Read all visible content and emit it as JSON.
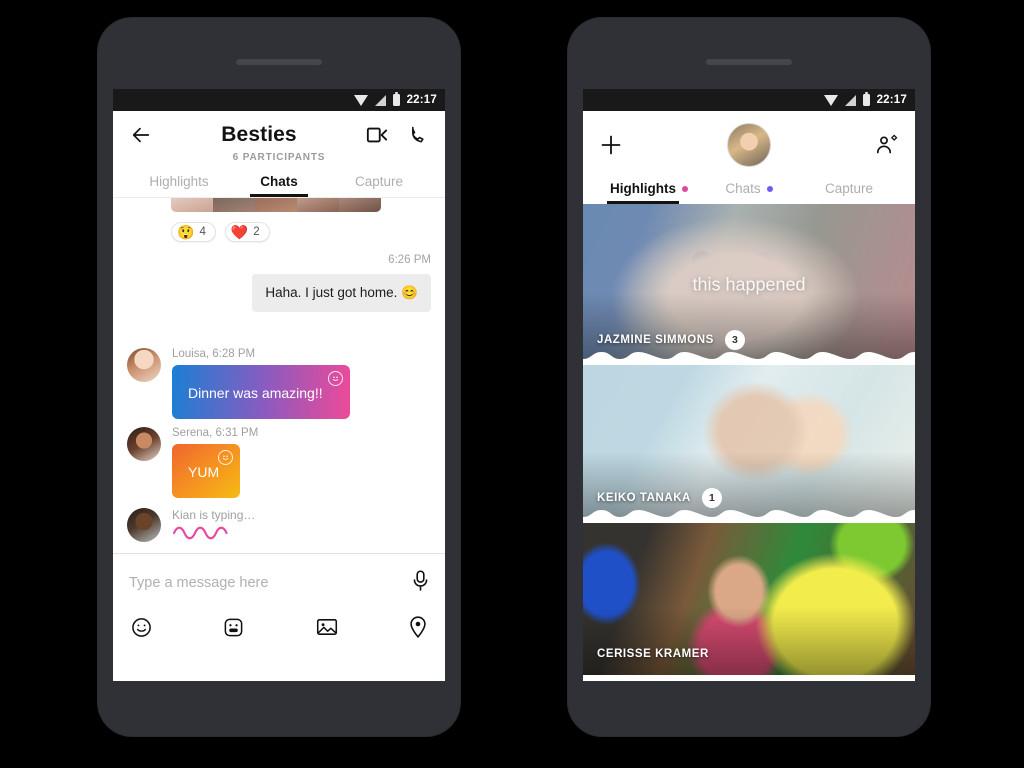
{
  "statusbar": {
    "time": "22:17",
    "icons": [
      "wifi-icon",
      "signal-icon",
      "battery-icon"
    ]
  },
  "left_phone": {
    "header": {
      "back_icon": "arrow-left-icon",
      "title": "Besties",
      "subtitle": "6 PARTICIPANTS",
      "video_icon": "video-call-icon",
      "call_icon": "phone-call-icon"
    },
    "tabs": [
      {
        "label": "Highlights",
        "active": false
      },
      {
        "label": "Chats",
        "active": true
      },
      {
        "label": "Capture",
        "active": false
      }
    ],
    "reactions": [
      {
        "emoji": "😲",
        "name": "astonished-face-emoji",
        "count": "4"
      },
      {
        "emoji": "❤️",
        "name": "heart-emoji",
        "count": "2"
      }
    ],
    "outgoing": {
      "timestamp": "6:26 PM",
      "text": "Haha. I just got home. 😊"
    },
    "messages": [
      {
        "meta": "Louisa, 6:28 PM",
        "sender": "Louisa",
        "time": "6:28 PM",
        "text": "Dinner was amazing!!",
        "style": "gradient-blue-pink"
      },
      {
        "meta": "Serena, 6:31 PM",
        "sender": "Serena",
        "time": "6:31 PM",
        "text": "YUM",
        "style": "gradient-orange-yellow"
      },
      {
        "meta": "Kian is typing…",
        "sender": "Kian",
        "text": "",
        "style": "typing-squiggle"
      }
    ],
    "composer": {
      "placeholder": "Type a message here",
      "mic_icon": "microphone-icon",
      "icons": [
        "emoji-icon",
        "sticker-icon",
        "image-icon",
        "location-icon"
      ]
    }
  },
  "right_phone": {
    "header": {
      "add_icon": "plus-icon",
      "profile_avatar": "user-avatar",
      "add_friend_icon": "add-person-icon"
    },
    "tabs": [
      {
        "label": "Highlights",
        "active": true,
        "dot": "#e0489b"
      },
      {
        "label": "Chats",
        "active": false,
        "dot": "#6a5df0"
      },
      {
        "label": "Capture",
        "active": false,
        "dot": ""
      }
    ],
    "cards": [
      {
        "name": "JAZMINE SIMMONS",
        "badge": "3",
        "overlay_text": "this happened",
        "tint": "#7d6fb5"
      },
      {
        "name": "KEIKO TANAKA",
        "badge": "1",
        "overlay_text": "",
        "tint": "#2f9fb8"
      },
      {
        "name": "CERISSE KRAMER",
        "badge": "",
        "overlay_text": "",
        "tint": "#000000"
      }
    ]
  },
  "colors": {
    "frame": "#2f3136",
    "statusbar": "#191919",
    "accent_pink": "#e0489b",
    "accent_purple": "#6a5df0",
    "bubble_blue": "#1a7fd4",
    "bubble_pink": "#ee4a98",
    "bubble_orange": "#f0652f",
    "bubble_yellow": "#f6bb14",
    "incoming_grey": "#ececec"
  }
}
